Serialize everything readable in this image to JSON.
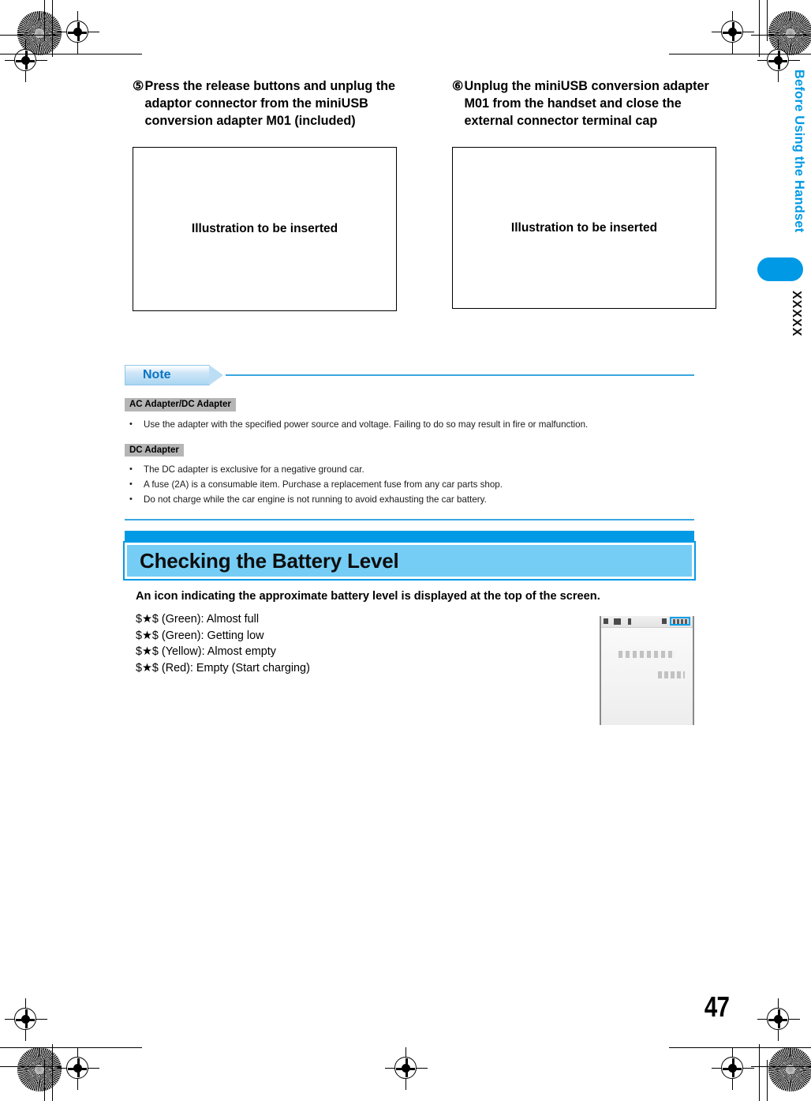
{
  "page": {
    "number": "47",
    "side_tab_title": "Before Using the Handset",
    "side_tab_code": "XXXXX",
    "accent_color": "#039ae5",
    "heading_fill": "#75cdf5",
    "note_rule_color": "#3aa7e0",
    "tag_gray": "#b5b5b5"
  },
  "steps": [
    {
      "number": "⑤",
      "text": "Press the release buttons and unplug the adaptor connector from the miniUSB conversion adapter M01 (included)",
      "illustration_placeholder": "Illustration to be inserted"
    },
    {
      "number": "⑥",
      "text": "Unplug the miniUSB conversion adapter M01 from the handset and close the external connector terminal cap",
      "illustration_placeholder": "Illustration to be inserted"
    }
  ],
  "note": {
    "label": "Note",
    "groups": [
      {
        "tag": "AC Adapter/DC Adapter",
        "bullets": [
          "Use the adapter with the specified power source and voltage. Failing to do so may result in fire or malfunction."
        ]
      },
      {
        "tag": "DC Adapter",
        "bullets": [
          "The DC adapter is exclusive for a negative ground car.",
          "A fuse (2A) is a consumable item. Purchase a replacement fuse from any car parts shop.",
          "Do not charge while the car engine is not running to avoid exhausting the car battery."
        ]
      }
    ],
    "bullet_char": "•"
  },
  "section": {
    "title": "Checking the Battery Level",
    "lede": "An icon indicating the approximate battery level is displayed at the top of the screen.",
    "battery_levels": [
      {
        "glyph": "$★$",
        "label": "(Green): Almost full"
      },
      {
        "glyph": "$★$",
        "label": "(Green): Getting low"
      },
      {
        "glyph": "$★$",
        "label": "(Yellow): Almost empty"
      },
      {
        "glyph": "$★$",
        "label": "(Red): Empty (Start charging)"
      }
    ]
  },
  "phone_screenshot": {
    "caption": "handset standby screen with battery icon highlighted",
    "highlight_color": "#0a9ee8"
  }
}
